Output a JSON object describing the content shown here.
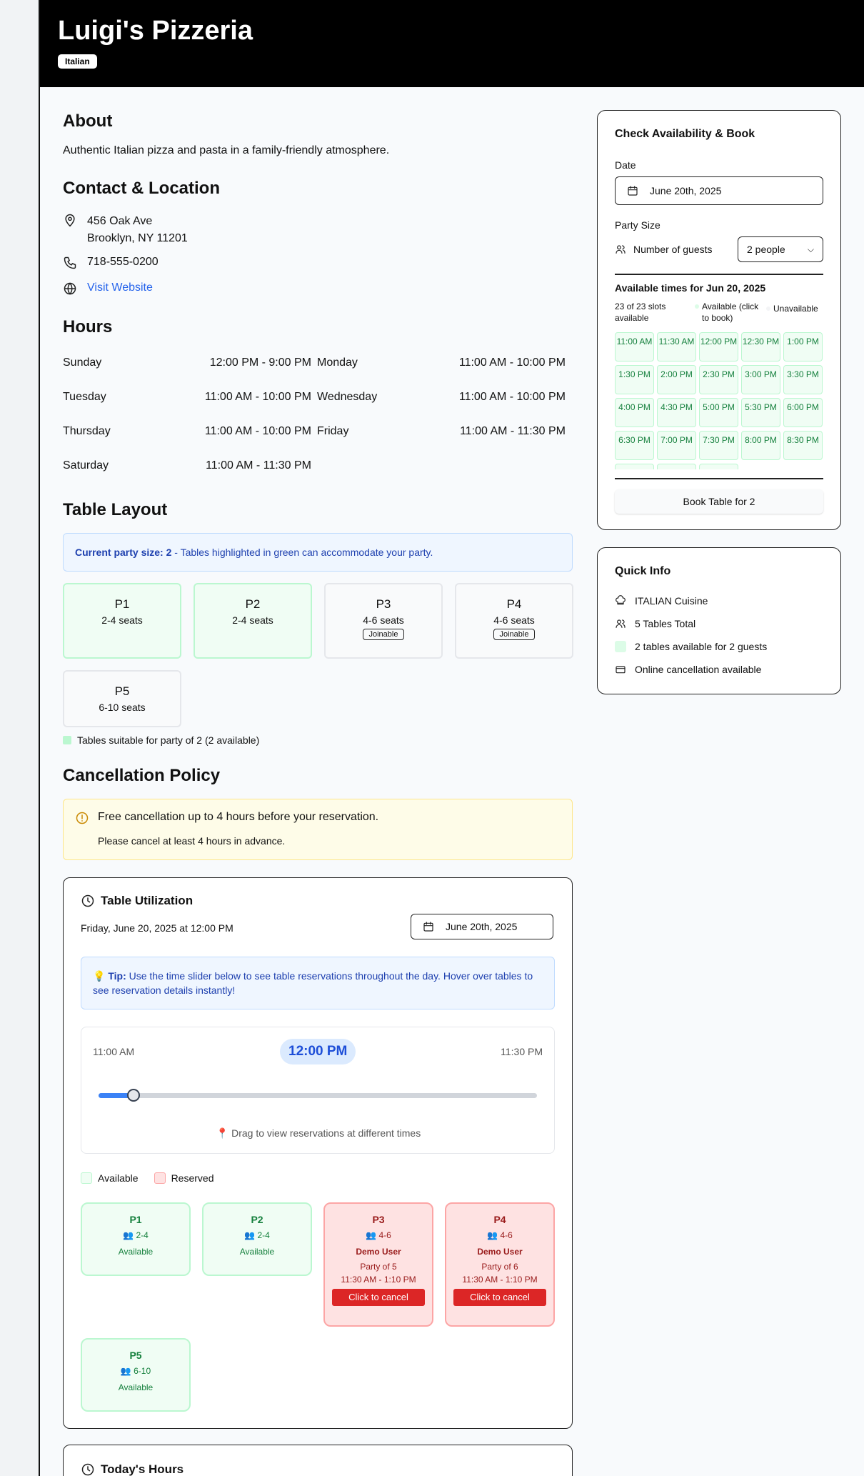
{
  "header": {
    "title": "Luigi's Pizzeria",
    "cuisine_tag": "Italian"
  },
  "about": {
    "heading": "About",
    "text": "Authentic Italian pizza and pasta in a family-friendly atmosphere."
  },
  "contact": {
    "heading": "Contact & Location",
    "address1": "456 Oak Ave",
    "address2": "Brooklyn, NY 11201",
    "phone": "718-555-0200",
    "website": "Visit Website"
  },
  "hours": {
    "heading": "Hours",
    "days": [
      {
        "day": "Sunday",
        "time": "12:00 PM - 9:00 PM"
      },
      {
        "day": "Monday",
        "time": "11:00 AM - 10:00 PM"
      },
      {
        "day": "Tuesday",
        "time": "11:00 AM - 10:00 PM"
      },
      {
        "day": "Wednesday",
        "time": "11:00 AM - 10:00 PM"
      },
      {
        "day": "Thursday",
        "time": "11:00 AM - 10:00 PM"
      },
      {
        "day": "Friday",
        "time": "11:00 AM - 11:30 PM"
      },
      {
        "day": "Saturday",
        "time": "11:00 AM - 11:30 PM"
      }
    ]
  },
  "layout": {
    "heading": "Table Layout",
    "note_bold": "Current party size: 2",
    "note_rest": " - Tables highlighted in green can accommodate your party.",
    "tables": [
      {
        "name": "P1",
        "seats": "2-4 seats",
        "joinable": ""
      },
      {
        "name": "P2",
        "seats": "2-4 seats",
        "joinable": ""
      },
      {
        "name": "P3",
        "seats": "4-6 seats",
        "joinable": "Joinable"
      },
      {
        "name": "P4",
        "seats": "4-6 seats",
        "joinable": "Joinable"
      },
      {
        "name": "P5",
        "seats": "6-10 seats",
        "joinable": ""
      }
    ],
    "legend": "Tables suitable for party of 2 (2 available)"
  },
  "cancellation": {
    "heading": "Cancellation Policy",
    "main": "Free cancellation up to 4 hours before your reservation.",
    "sub": "Please cancel at least 4 hours in advance."
  },
  "utilization": {
    "title": "Table Utilization",
    "datetime": "Friday, June 20, 2025 at 12:00 PM",
    "date_value": "June 20th, 2025",
    "tip_bold": "Tip:",
    "tip_rest": " Use the time slider below to see table reservations throughout the day. Hover over tables to see reservation details instantly!",
    "start": "11:00 AM",
    "current": "12:00 PM",
    "end": "11:30 PM",
    "slider_fraction": 0.08,
    "drag_hint": "Drag to view reservations at different times",
    "legend_available": "Available",
    "legend_reserved": "Reserved",
    "tables": [
      {
        "name": "P1",
        "size": "2-4",
        "status": "Available"
      },
      {
        "name": "P2",
        "size": "2-4",
        "status": "Available"
      },
      {
        "name": "P3",
        "size": "4-6",
        "user": "Demo User",
        "party": "Party of 5",
        "time": "11:30 AM - 1:10 PM",
        "cancel": "Click to cancel"
      },
      {
        "name": "P4",
        "size": "4-6",
        "user": "Demo User",
        "party": "Party of 6",
        "time": "11:30 AM - 1:10 PM",
        "cancel": "Click to cancel"
      },
      {
        "name": "P5",
        "size": "6-10",
        "status": "Available"
      }
    ]
  },
  "todays_hours": {
    "title": "Today's Hours"
  },
  "booking": {
    "title": "Check Availability & Book",
    "date_label": "Date",
    "date_value": "June 20th, 2025",
    "party_label": "Party Size",
    "guests_label": "Number of guests",
    "party_value": "2 people",
    "times_heading": "Available times for Jun 20, 2025",
    "slots_count": "23 of 23 slots available",
    "available_legend": "Available (click to book)",
    "unavailable_legend": "Unavailable",
    "slots": [
      "11:00 AM",
      "11:30 AM",
      "12:00 PM",
      "12:30 PM",
      "1:00 PM",
      "1:30 PM",
      "2:00 PM",
      "2:30 PM",
      "3:00 PM",
      "3:30 PM",
      "4:00 PM",
      "4:30 PM",
      "5:00 PM",
      "5:30 PM",
      "6:00 PM",
      "6:30 PM",
      "7:00 PM",
      "7:30 PM",
      "8:00 PM",
      "8:30 PM"
    ],
    "book_button": "Book Table for 2"
  },
  "quick_info": {
    "title": "Quick Info",
    "cuisine": "ITALIAN Cuisine",
    "tables_total": "5 Tables Total",
    "availability": "2 tables available for 2 guests",
    "cancellation": "Online cancellation available"
  },
  "colors": {
    "available": "#f0fdf4",
    "reserved": "#fee2e2",
    "accent": "#3b82f6",
    "cancel": "#dc2626"
  }
}
